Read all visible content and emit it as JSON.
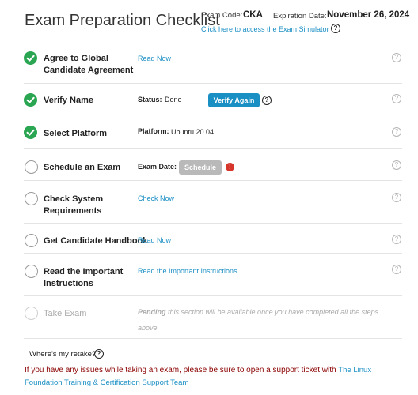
{
  "header": {
    "title": "Exam Preparation Checklist",
    "exam_code_label": "Exam Code:",
    "exam_code": "CKA",
    "expiration_label": "Expiration Date:",
    "expiration_date": "November 26, 2024",
    "simulator_link": "Click here to access the Exam Simulator"
  },
  "items": [
    {
      "label": "Agree to Global Candidate Agreement",
      "status": "complete",
      "link": "Read Now"
    },
    {
      "label": "Verify Name",
      "status": "complete",
      "field_label": "Status:",
      "field_value": "Done",
      "button": "Verify Again"
    },
    {
      "label": "Select Platform",
      "status": "complete",
      "field_label": "Platform:",
      "field_value": "Ubuntu 20.04"
    },
    {
      "label": "Schedule an Exam",
      "status": "incomplete",
      "field_label": "Exam Date:",
      "button": "Schedule"
    },
    {
      "label": "Check System Requirements",
      "status": "incomplete",
      "link": "Check Now"
    },
    {
      "label": "Get Candidate Handbook",
      "status": "incomplete",
      "link": "Read Now"
    },
    {
      "label": "Read the Important Instructions",
      "status": "incomplete",
      "link": "Read the Important Instructions"
    },
    {
      "label": "Take Exam",
      "status": "disabled",
      "pending_word": "Pending",
      "pending_text": " this section will be available once you have completed all the steps above"
    }
  ],
  "retake": {
    "label": "Where's my retake?"
  },
  "footer": {
    "message": "If you have any issues while taking an exam, please be sure to open a support ticket with ",
    "link": "The Linux Foundation Training & Certification Support Team"
  },
  "icons": {
    "check": "check-icon",
    "help": "help-icon",
    "info": "info-icon",
    "warning": "warning-icon"
  },
  "colors": {
    "accent": "#1a8fc4",
    "complete": "#2aa552",
    "warning": "#d5352b",
    "footer_text": "#8b0000"
  }
}
